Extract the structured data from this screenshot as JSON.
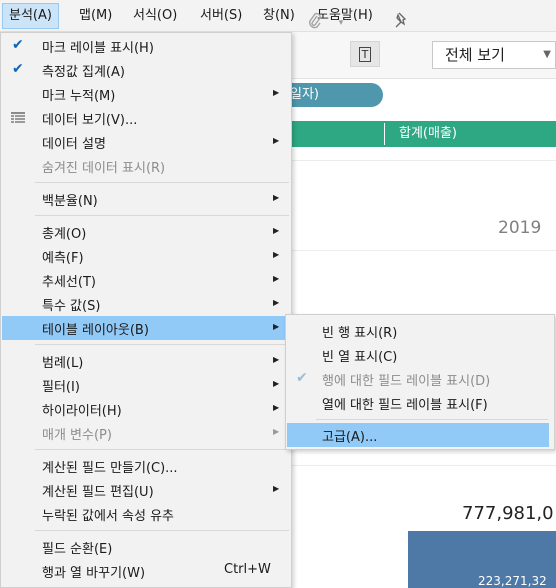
{
  "menubar": {
    "items": [
      "분석(A)",
      "맵(M)",
      "서식(O)",
      "서버(S)",
      "창(N)",
      "도움말(H)"
    ]
  },
  "workspace": {
    "view_select": "전체 보기",
    "pill_text": "일자)",
    "header_cell_label": "합계(매출)",
    "year_label": "2019",
    "total_value": "777,981,0",
    "bar_value": "223,271,32"
  },
  "menu": {
    "items": [
      {
        "label": "마크 레이블 표시(H)",
        "checked": true
      },
      {
        "label": "측정값 집계(A)",
        "checked": true
      },
      {
        "label": "마크 누적(M)",
        "submenu": true
      },
      {
        "label": "데이터 보기(V)...",
        "icon": "data-grid-icon"
      },
      {
        "label": "데이터 설명",
        "submenu": true
      },
      {
        "label": "숨겨진 데이터 표시(R)",
        "disabled": true
      },
      {
        "label": "백분율(N)",
        "submenu": true
      },
      {
        "label": "총계(O)",
        "submenu": true
      },
      {
        "label": "예측(F)",
        "submenu": true
      },
      {
        "label": "추세선(T)",
        "submenu": true
      },
      {
        "label": "특수 값(S)",
        "submenu": true
      },
      {
        "label": "테이블 레이아웃(B)",
        "submenu": true,
        "highlighted": true
      },
      {
        "label": "범례(L)",
        "submenu": true
      },
      {
        "label": "필터(I)",
        "submenu": true
      },
      {
        "label": "하이라이터(H)",
        "submenu": true
      },
      {
        "label": "매개 변수(P)",
        "submenu": true,
        "disabled": true
      },
      {
        "label": "계산된 필드 만들기(C)..."
      },
      {
        "label": "계산된 필드 편집(U)",
        "submenu": true
      },
      {
        "label": "누락된 값에서 속성 유추"
      },
      {
        "label": "필드 순환(E)"
      },
      {
        "label": "행과 열 바꾸기(W)",
        "shortcut": "Ctrl+W"
      }
    ]
  },
  "submenu": {
    "items": [
      {
        "label": "빈 행 표시(R)"
      },
      {
        "label": "빈 열 표시(C)"
      },
      {
        "label": "행에 대한 필드 레이블 표시(D)",
        "disabled": true,
        "checked": true
      },
      {
        "label": "열에 대한 필드 레이블 표시(F)"
      },
      {
        "label": "고급(A)...",
        "highlighted": true
      }
    ]
  },
  "colors": {
    "menu_bg": "#f2f2f2",
    "highlight": "#91c9f7",
    "check": "#0e64b4",
    "pill": "#4e97ad",
    "header_green": "#2ea882",
    "bar_blue": "#4e79a7"
  }
}
